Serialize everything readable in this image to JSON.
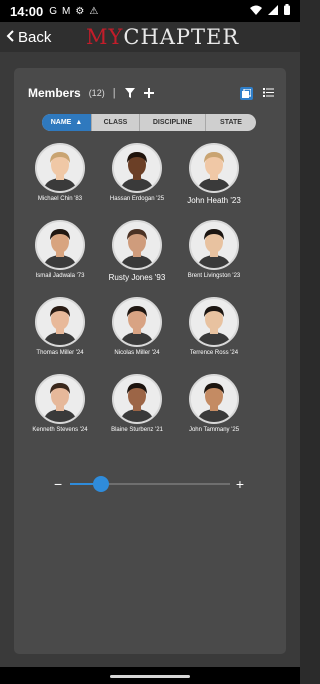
{
  "status_bar": {
    "time": "14:00",
    "left_icons": [
      "G",
      "M",
      "⚙",
      "⚠"
    ]
  },
  "header": {
    "back_label": "Back",
    "logo_part1": "MY",
    "logo_part2": "CHAPTER"
  },
  "members": {
    "title": "Members",
    "count": "(12)",
    "separator": "|"
  },
  "sort_tabs": [
    {
      "label": "NAME",
      "active": true
    },
    {
      "label": "CLASS",
      "active": false
    },
    {
      "label": "DISCIPLINE",
      "active": false
    },
    {
      "label": "STATE",
      "active": false
    }
  ],
  "member_list": [
    {
      "name": "Michael Chin '83",
      "skin": "#f0c8a6",
      "hair": "#c9a472"
    },
    {
      "name": "Hassan Erdogan '25",
      "skin": "#6b3f26",
      "hair": "#1f130c"
    },
    {
      "name": "John Heath '23",
      "skin": "#f0c8a6",
      "hair": "#c9a472"
    },
    {
      "name": "Ismail Jadwala '73",
      "skin": "#d8a47f",
      "hair": "#201711"
    },
    {
      "name": "Rusty Jones '93",
      "skin": "#cf9c7c",
      "hair": "#4b3224"
    },
    {
      "name": "Brent Livingston '23",
      "skin": "#e8c2a0",
      "hair": "#1b1511"
    },
    {
      "name": "Thomas Miller '24",
      "skin": "#e8b99a",
      "hair": "#2a1c14"
    },
    {
      "name": "Nicolas Miller '24",
      "skin": "#d8a383",
      "hair": "#1f1712"
    },
    {
      "name": "Terrence Ross '24",
      "skin": "#e8c2a0",
      "hair": "#1b1511"
    },
    {
      "name": "Kenneth Stevens '24",
      "skin": "#e6b89a",
      "hair": "#3a281c"
    },
    {
      "name": "Blaine Sturbenz '21",
      "skin": "#9c6546",
      "hair": "#1c130e"
    },
    {
      "name": "John Tammany '25",
      "skin": "#c48b63",
      "hair": "#1c1510"
    }
  ],
  "slider": {
    "minus": "−",
    "plus": "+",
    "value": 0.14
  },
  "colors": {
    "accent": "#2f79be",
    "logo_red": "#c21d2a"
  }
}
